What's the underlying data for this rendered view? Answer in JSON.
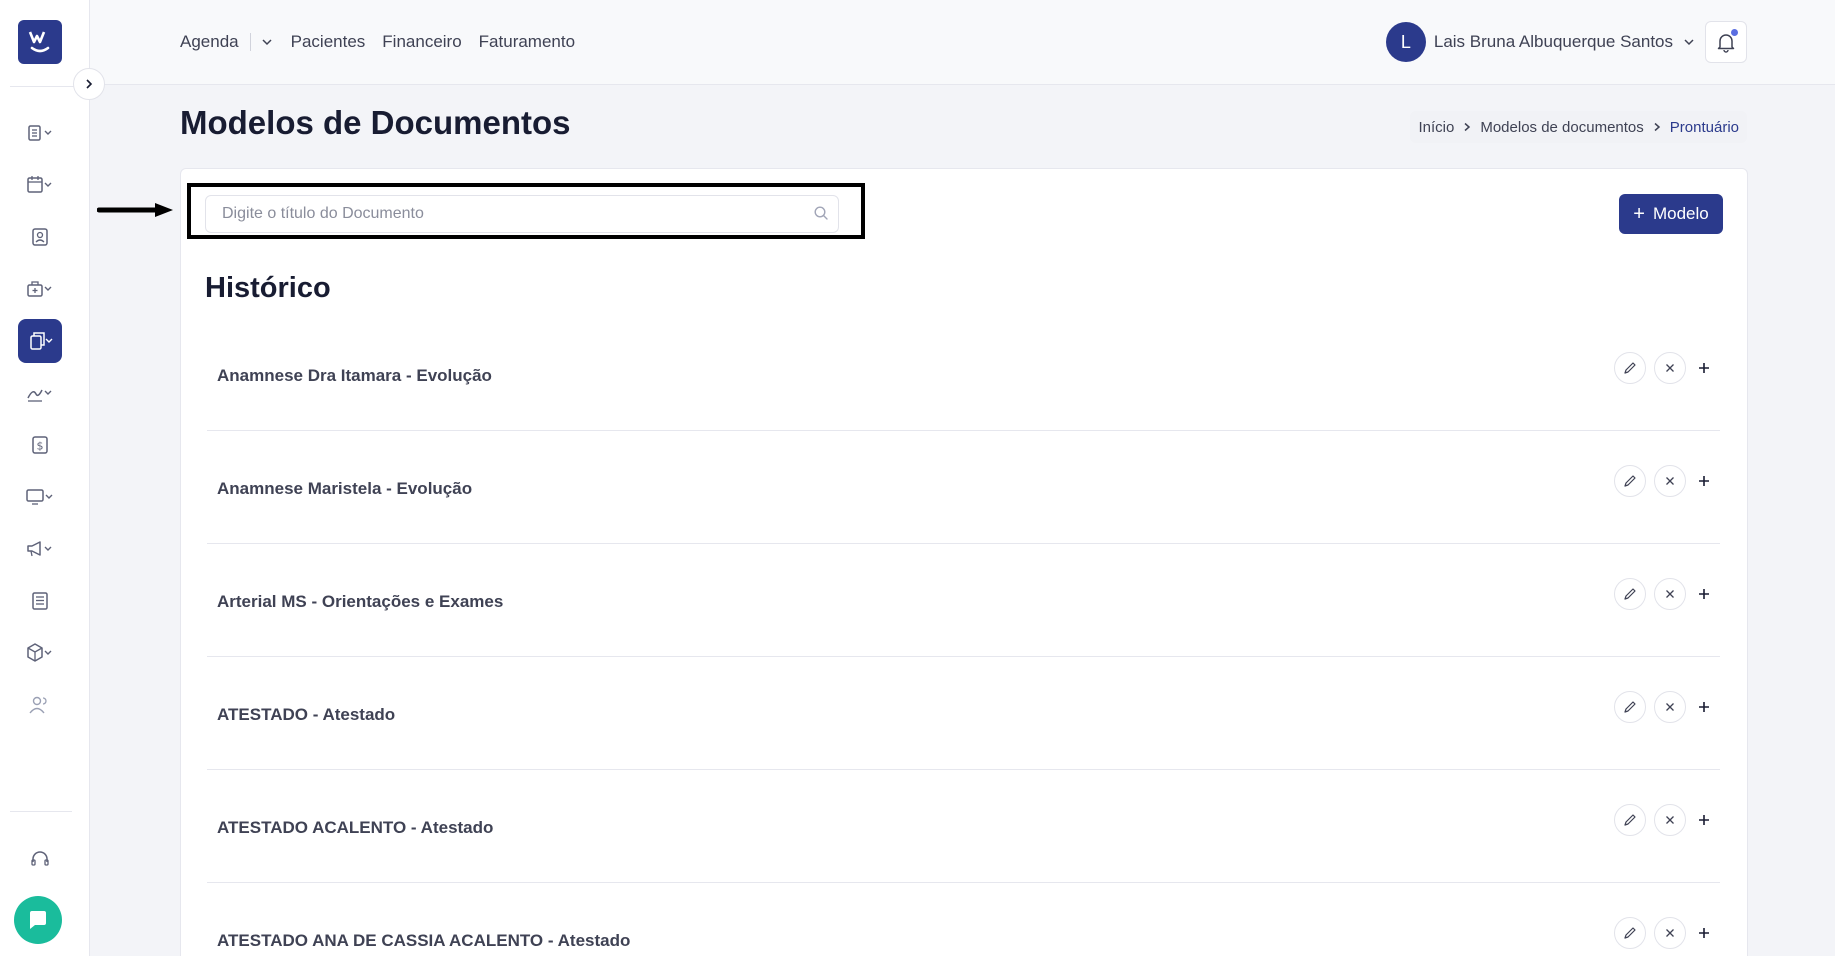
{
  "brand": {
    "logo_letter": "W"
  },
  "topnav": {
    "items": [
      "Agenda",
      "Pacientes",
      "Financeiro",
      "Faturamento"
    ]
  },
  "user": {
    "initial": "L",
    "name": "Lais Bruna Albuquerque Santos"
  },
  "page": {
    "title": "Modelos de Documentos"
  },
  "breadcrumb": {
    "items": [
      "Início",
      "Modelos de documentos",
      "Prontuário"
    ]
  },
  "search": {
    "placeholder": "Digite o título do Documento",
    "value": ""
  },
  "add_button": {
    "label": "Modelo"
  },
  "section": {
    "title": "Histórico"
  },
  "documents": [
    "Anamnese Dra Itamara - Evolução",
    "Anamnese Maristela - Evolução",
    "Arterial MS - Orientações e Exames",
    "ATESTADO - Atestado",
    "ATESTADO ACALENTO - Atestado",
    "ATESTADO ANA DE CASSIA ACALENTO - Atestado"
  ],
  "sidebar_icons": [
    "records-icon",
    "calendar-icon",
    "contact-card-icon",
    "medical-bag-icon",
    "documents-icon",
    "pen-signature-icon",
    "dollar-icon",
    "monitor-icon",
    "megaphone-icon",
    "newspaper-icon",
    "box-icon",
    "users-icon"
  ],
  "colors": {
    "primary": "#2b3a8c",
    "chat": "#1abc9c",
    "notification_dot": "#5b6ee1"
  }
}
